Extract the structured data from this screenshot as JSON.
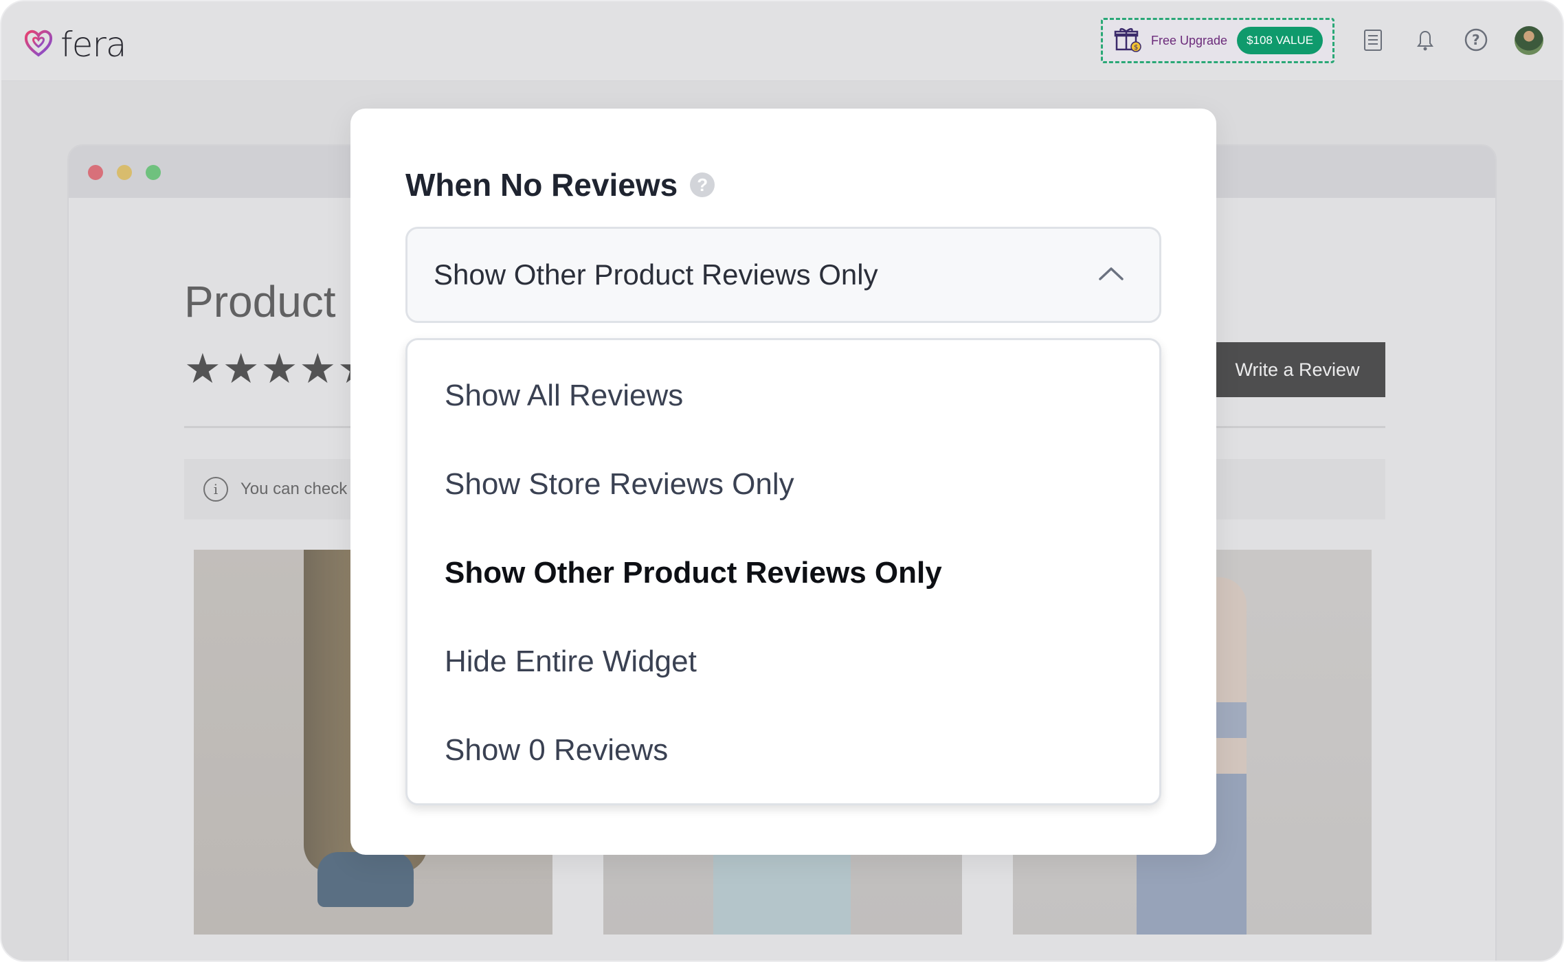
{
  "app": {
    "logo_text": "fera"
  },
  "topbar": {
    "upgrade_label": "Free Upgrade",
    "upgrade_badge": "$108 VALUE",
    "icons": [
      "checklist-icon",
      "bell-icon",
      "help-icon",
      "user-avatar"
    ]
  },
  "background": {
    "product_title": "Product R",
    "stars": "★★★★★",
    "write_review_label": "Write a Review",
    "info_text": "You can check o",
    "window_dots": [
      "#e0414f",
      "#e0b53b",
      "#3fbe55"
    ]
  },
  "modal": {
    "title": "When No Reviews",
    "select": {
      "value": "Show Other Product Reviews Only"
    },
    "options": [
      {
        "label": "Show All Reviews",
        "selected": false
      },
      {
        "label": "Show Store Reviews Only",
        "selected": false
      },
      {
        "label": "Show Other Product Reviews Only",
        "selected": true
      },
      {
        "label": "Hide Entire Widget",
        "selected": false
      },
      {
        "label": "Show 0 Reviews",
        "selected": false
      }
    ]
  },
  "colors": {
    "accent_green": "#0f9a6c",
    "upgrade_text": "#6b2a7a",
    "dashed_border": "#2aa876",
    "logo_gradient": [
      "#e8426f",
      "#7b4fd6"
    ]
  }
}
